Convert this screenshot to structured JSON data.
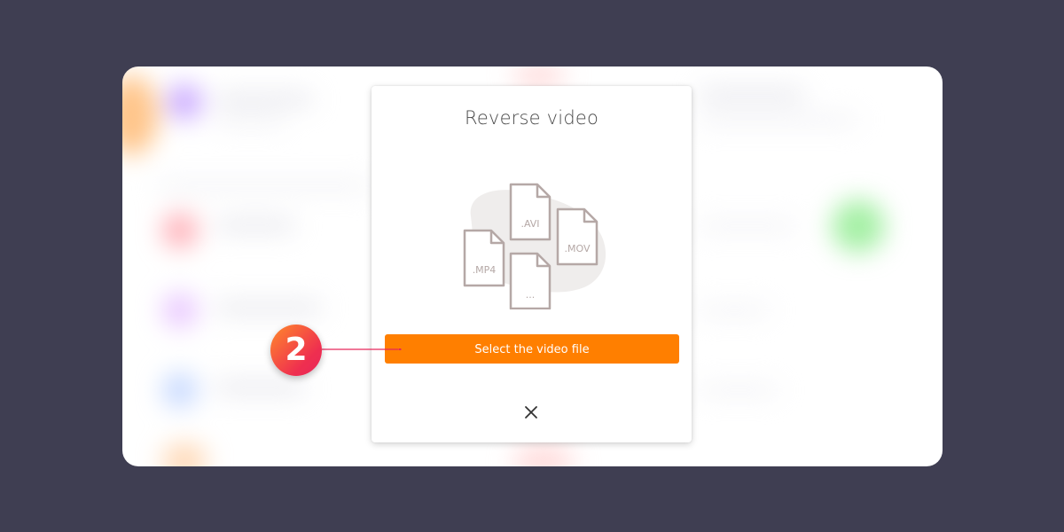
{
  "modal": {
    "title": "Reverse video",
    "select_button_label": "Select the video file",
    "close_icon": "close-icon"
  },
  "illustration": {
    "files": [
      ".AVI",
      ".MOV",
      ".MP4",
      "..."
    ]
  },
  "annotation": {
    "step_number": "2"
  },
  "colors": {
    "backdrop": "#3f3e52",
    "accent": "#ff7f00",
    "badge_start": "#ff8a2b",
    "badge_end": "#e8275a",
    "file_stroke": "#b5a8a6"
  }
}
